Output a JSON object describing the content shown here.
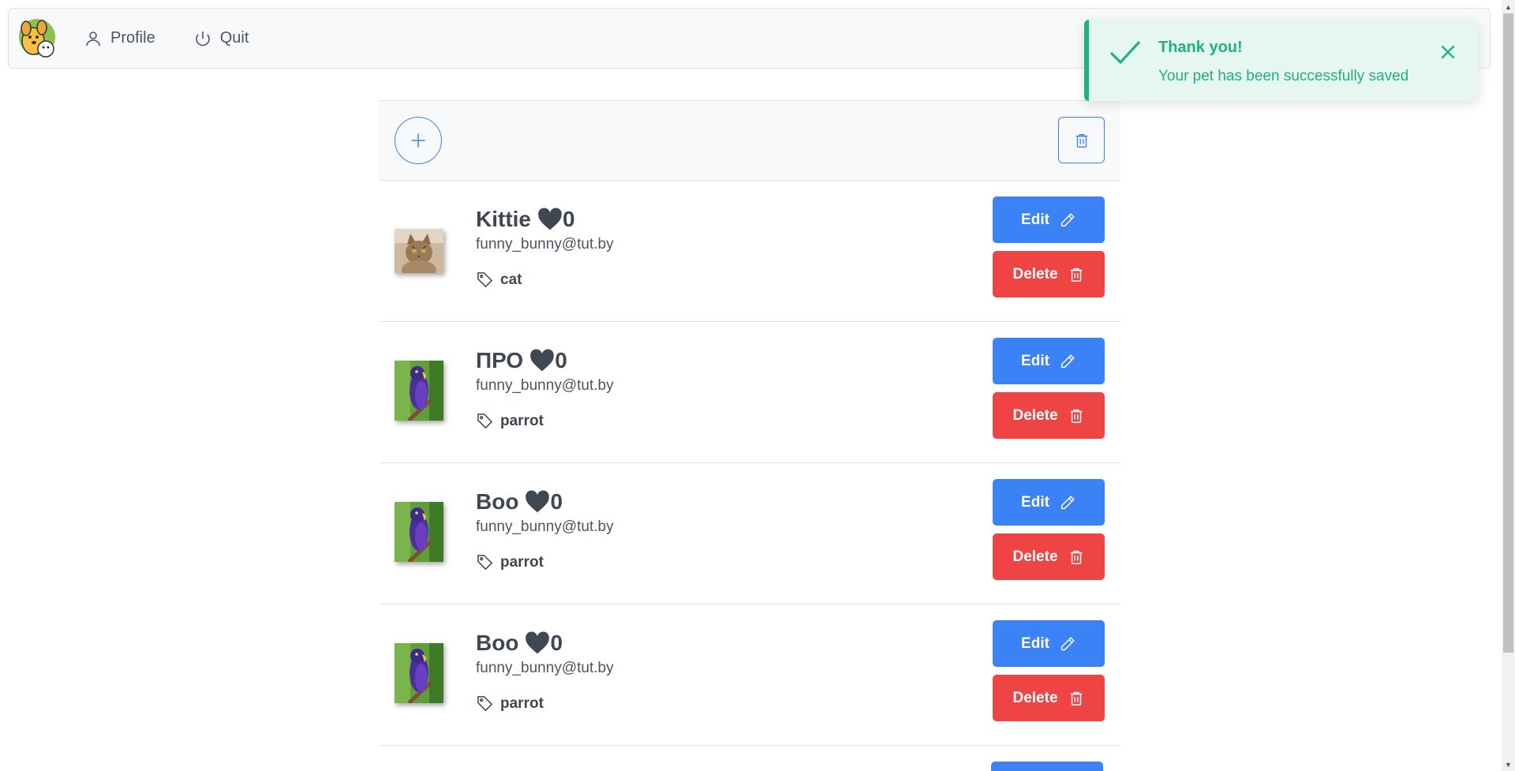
{
  "nav": {
    "logo_alt": "pets logo",
    "profile_label": "Profile",
    "quit_label": "Quit"
  },
  "toolbar": {
    "add_icon": "plus-icon",
    "bulk_delete_icon": "trash-icon"
  },
  "pets": [
    {
      "name": "Kittie",
      "likes": "0",
      "owner": "funny_bunny@tut.by",
      "tag": "cat",
      "photo": "cat"
    },
    {
      "name": "ПРО",
      "likes": "0",
      "owner": "funny_bunny@tut.by",
      "tag": "parrot",
      "photo": "parrot"
    },
    {
      "name": "Boo",
      "likes": "0",
      "owner": "funny_bunny@tut.by",
      "tag": "parrot",
      "photo": "parrot"
    },
    {
      "name": "Boo",
      "likes": "0",
      "owner": "funny_bunny@tut.by",
      "tag": "parrot",
      "photo": "parrot"
    }
  ],
  "actions": {
    "edit_label": "Edit",
    "delete_label": "Delete"
  },
  "toast": {
    "title": "Thank you!",
    "message": "Your pet has been successfully saved"
  },
  "colors": {
    "primary": "#3b82f6",
    "danger": "#ef4444",
    "success": "#22b07d",
    "success_bg": "#e5f7ef"
  }
}
